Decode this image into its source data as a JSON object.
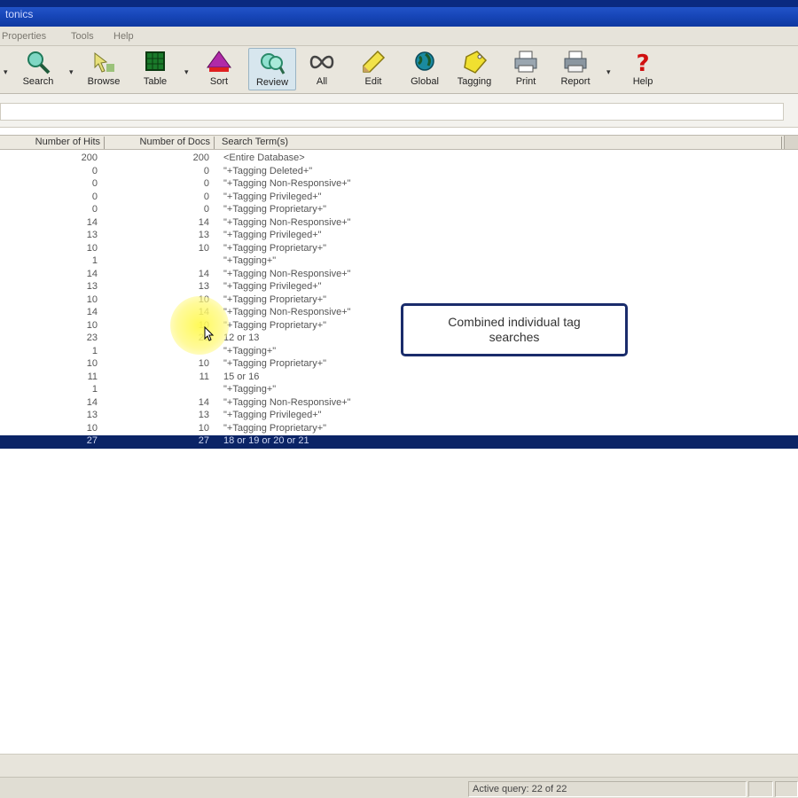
{
  "window": {
    "title": "tonics"
  },
  "menu": {
    "items": [
      "Properties",
      "Tools",
      "Help"
    ]
  },
  "toolbar": {
    "buttons": [
      {
        "label": "Search",
        "icon": "search-icon"
      },
      {
        "label": "Browse",
        "icon": "browse-icon"
      },
      {
        "label": "Table",
        "icon": "table-icon"
      },
      {
        "label": "Sort",
        "icon": "sort-icon"
      },
      {
        "label": "Review",
        "icon": "review-icon"
      },
      {
        "label": "All",
        "icon": "infinity-icon"
      },
      {
        "label": "Edit",
        "icon": "pencil-icon"
      },
      {
        "label": "Global",
        "icon": "globe-icon"
      },
      {
        "label": "Tagging",
        "icon": "tag-icon"
      },
      {
        "label": "Print",
        "icon": "printer-icon"
      },
      {
        "label": "Report",
        "icon": "report-icon"
      },
      {
        "label": "Help",
        "icon": "help-icon"
      }
    ]
  },
  "grid": {
    "headers": {
      "hits": "Number of Hits",
      "docs": "Number of Docs",
      "term": "Search Term(s)"
    },
    "rows": [
      {
        "hits": "200",
        "docs": "200",
        "term": "<Entire Database>"
      },
      {
        "hits": "0",
        "docs": "0",
        "term": "\"+Tagging Deleted+\""
      },
      {
        "hits": "0",
        "docs": "0",
        "term": "\"+Tagging Non-Responsive+\""
      },
      {
        "hits": "0",
        "docs": "0",
        "term": "\"+Tagging Privileged+\""
      },
      {
        "hits": "0",
        "docs": "0",
        "term": "\"+Tagging Proprietary+\""
      },
      {
        "hits": "14",
        "docs": "14",
        "term": "\"+Tagging Non-Responsive+\""
      },
      {
        "hits": "13",
        "docs": "13",
        "term": "\"+Tagging Privileged+\""
      },
      {
        "hits": "10",
        "docs": "10",
        "term": "\"+Tagging Proprietary+\""
      },
      {
        "hits": "1",
        "docs": "",
        "term": "\"+Tagging+\""
      },
      {
        "hits": "14",
        "docs": "14",
        "term": "\"+Tagging Non-Responsive+\""
      },
      {
        "hits": "13",
        "docs": "13",
        "term": "\"+Tagging Privileged+\""
      },
      {
        "hits": "10",
        "docs": "10",
        "term": "\"+Tagging Proprietary+\""
      },
      {
        "hits": "14",
        "docs": "14",
        "term": "\"+Tagging Non-Responsive+\""
      },
      {
        "hits": "10",
        "docs": "10",
        "term": "\"+Tagging Proprietary+\""
      },
      {
        "hits": "23",
        "docs": "23",
        "term": "12 or 13"
      },
      {
        "hits": "1",
        "docs": "",
        "term": "\"+Tagging+\""
      },
      {
        "hits": "10",
        "docs": "10",
        "term": "\"+Tagging Proprietary+\""
      },
      {
        "hits": "11",
        "docs": "11",
        "term": "15 or 16"
      },
      {
        "hits": "1",
        "docs": "",
        "term": "\"+Tagging+\""
      },
      {
        "hits": "14",
        "docs": "14",
        "term": "\"+Tagging Non-Responsive+\""
      },
      {
        "hits": "13",
        "docs": "13",
        "term": "\"+Tagging Privileged+\""
      },
      {
        "hits": "10",
        "docs": "10",
        "term": "\"+Tagging Proprietary+\""
      },
      {
        "hits": "27",
        "docs": "27",
        "term": "18 or 19 or 20 or 21"
      }
    ]
  },
  "callout": {
    "line1": "Combined individual tag",
    "line2": "searches"
  },
  "status": {
    "active_query": "Active query: 22 of 22"
  },
  "colors": {
    "selection": "#0b2466",
    "titlebar": "#1746b8",
    "callout_border": "#1a2c6b",
    "highlight": "#fff850"
  }
}
